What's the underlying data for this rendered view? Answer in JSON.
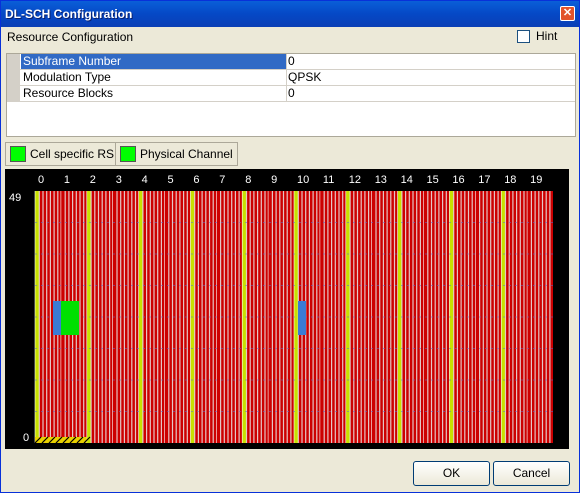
{
  "window": {
    "title": "DL-SCH Configuration",
    "close_glyph": "✕"
  },
  "resource_config": {
    "label": "Resource Configuration",
    "hint_label": "Hint",
    "hint_checked": false
  },
  "properties": [
    {
      "name": "Subframe Number",
      "value": "0"
    },
    {
      "name": "Modulation Type",
      "value": "QPSK"
    },
    {
      "name": "Resource Blocks",
      "value": "0"
    }
  ],
  "legend": [
    {
      "label": "Cell specific RS",
      "color": "#00ff00"
    },
    {
      "label": "Physical Channel",
      "color": "#00ff00"
    }
  ],
  "grid": {
    "columns": [
      "0",
      "1",
      "2",
      "3",
      "4",
      "5",
      "6",
      "7",
      "8",
      "9",
      "10",
      "11",
      "12",
      "13",
      "14",
      "15",
      "16",
      "17",
      "18",
      "19"
    ],
    "y_max_label": "49",
    "y_min_label": "0",
    "colors": {
      "background": "#cc0000",
      "stripe": "#e8e8e8",
      "control": "#c8e000",
      "highlight_green": "#00e000",
      "highlight_blue": "#3a7bd5",
      "sync": "#e8d000"
    }
  },
  "buttons": {
    "ok": "OK",
    "cancel": "Cancel"
  }
}
